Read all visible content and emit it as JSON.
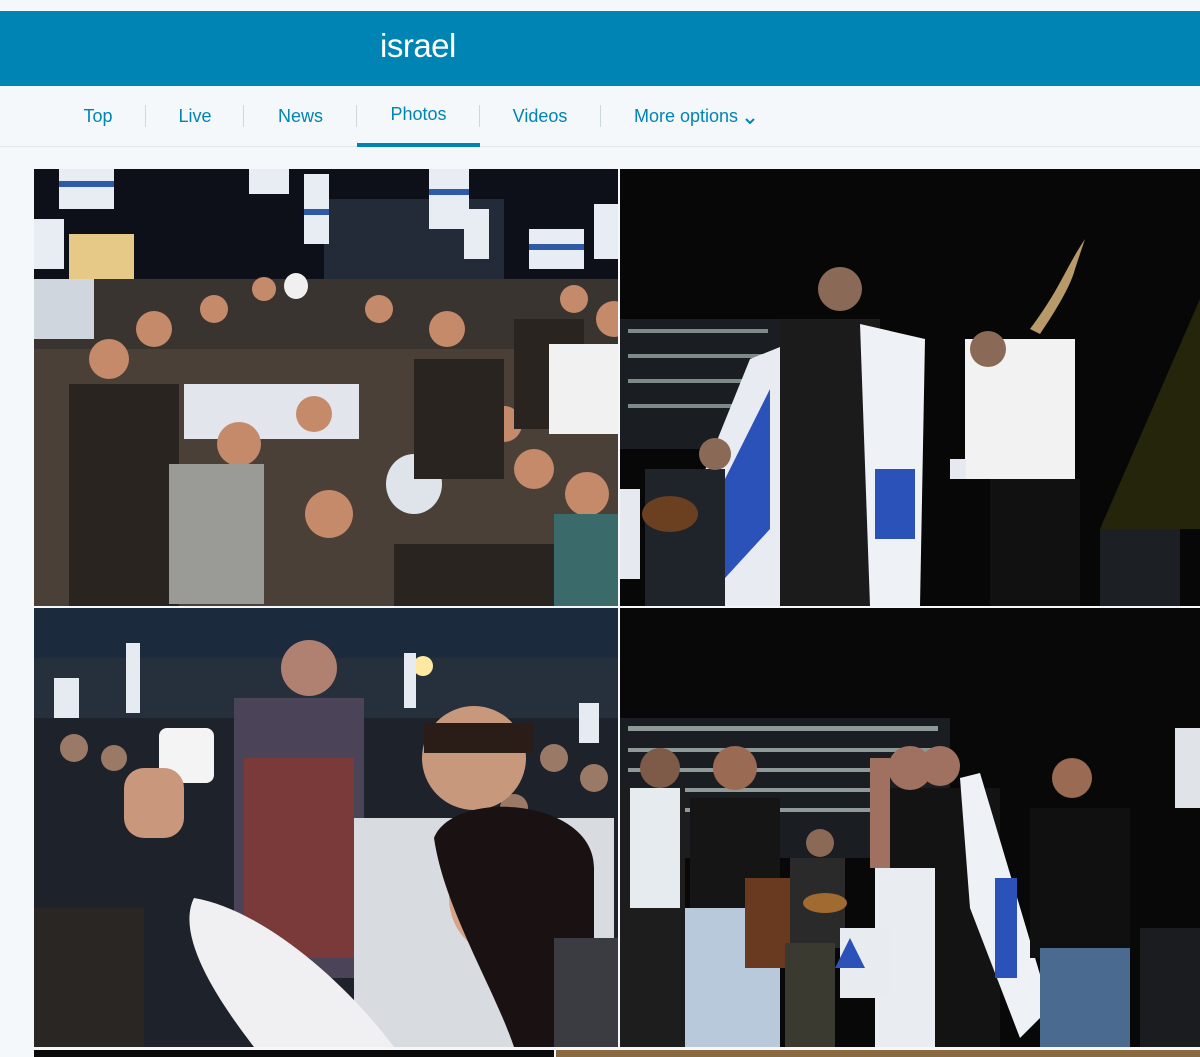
{
  "header": {
    "title": "israel"
  },
  "tabs": [
    {
      "label": "Top",
      "active": false
    },
    {
      "label": "Live",
      "active": false
    },
    {
      "label": "News",
      "active": false
    },
    {
      "label": "Photos",
      "active": true
    },
    {
      "label": "Videos",
      "active": false
    },
    {
      "label": "More options",
      "active": false,
      "icon": "chevron-down-icon"
    }
  ],
  "photos": [
    {
      "description": "Night rally crowd with Israeli flags and Hebrew signs"
    },
    {
      "description": "Singer on stage wrapped in Israeli flag, man blowing shofar"
    },
    {
      "description": "Woman taking selfie in crowd at night rally"
    },
    {
      "description": "Group on stage with Israeli flag, guitarist and microphone"
    }
  ],
  "colors": {
    "brand": "#0084b4",
    "background": "#f5f8fa",
    "tab_separator": "#ccd6dd"
  }
}
